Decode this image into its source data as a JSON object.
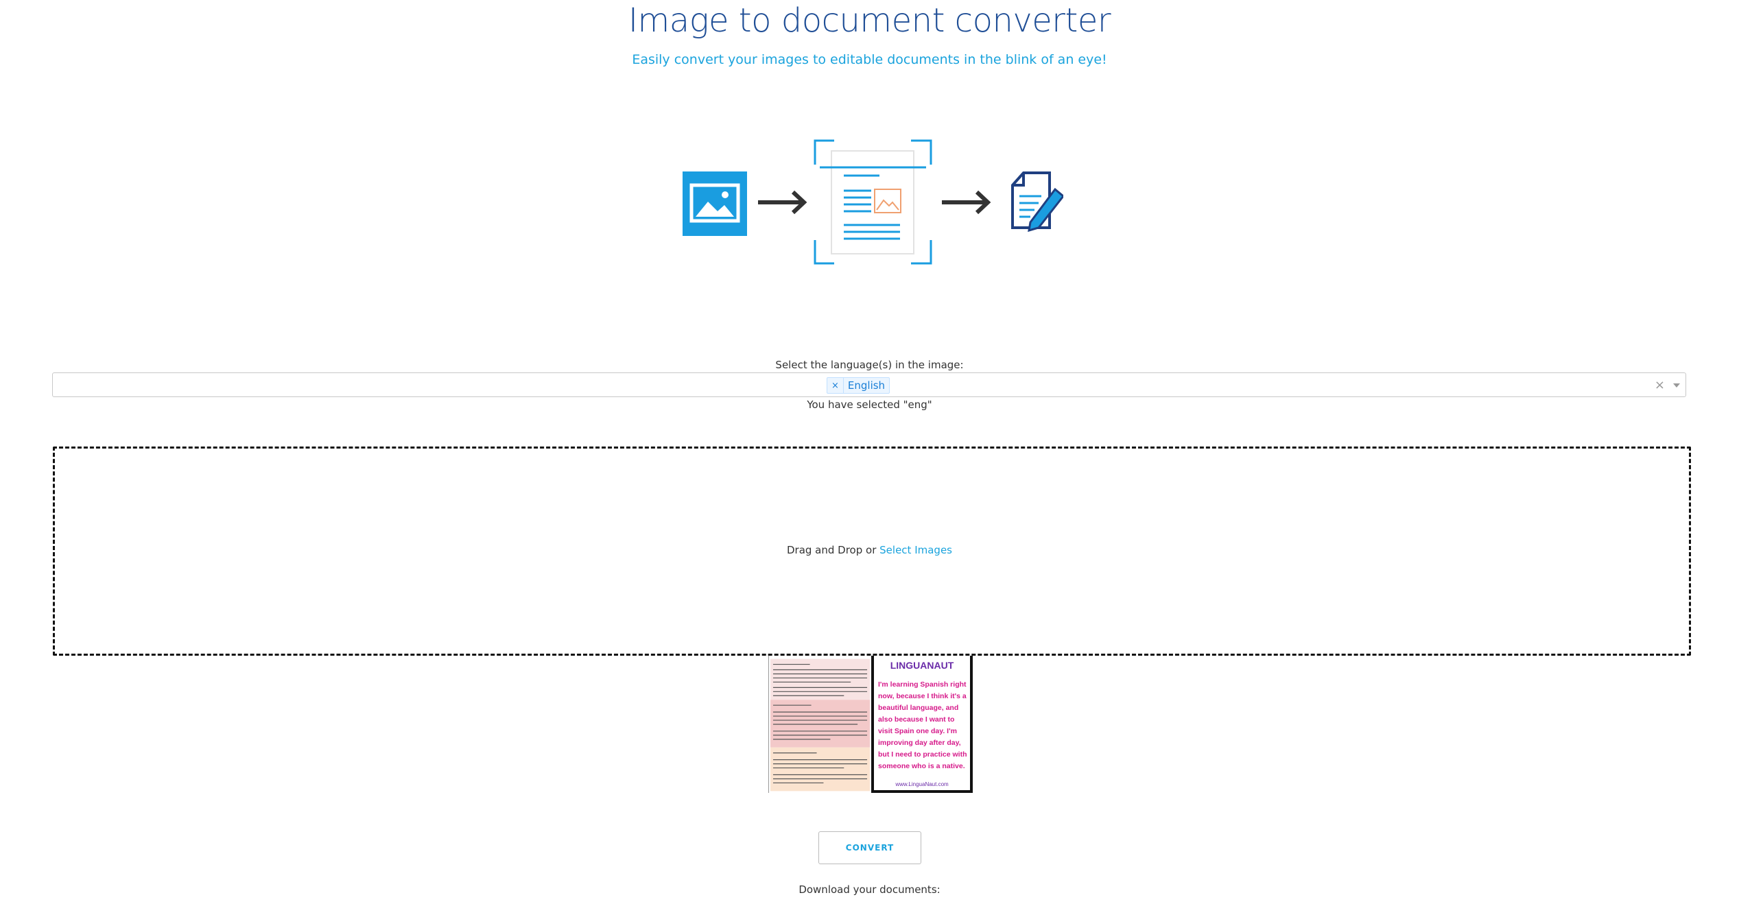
{
  "header": {
    "title": "Image to document converter",
    "subtitle": "Easily convert your images to editable documents in the blink of an eye!"
  },
  "language": {
    "label": "Select the language(s) in the image:",
    "selected_tags": [
      "English"
    ],
    "remove_symbol": "×",
    "clear_symbol": "×",
    "selected_message": "You have selected \"eng\""
  },
  "dropzone": {
    "text": "Drag and Drop or",
    "link": "Select Images"
  },
  "thumbnails": {
    "second_title": "LINGUANAUT",
    "second_body": "I'm learning Spanish right now, because I think it's a beautiful language, and also because I want to visit Spain one day. I'm improving day after day, but I need to practice with someone who is a native.",
    "second_footer": "www.LinguaNaut.com"
  },
  "actions": {
    "convert": "CONVERT",
    "download_label": "Download your documents:"
  },
  "colors": {
    "title": "#1f4e96",
    "accent": "#1aa3dd",
    "icon_blue": "#1a9de0"
  },
  "icons": [
    "image-icon",
    "arrow-right-icon",
    "scan-document-icon",
    "edit-document-icon"
  ]
}
